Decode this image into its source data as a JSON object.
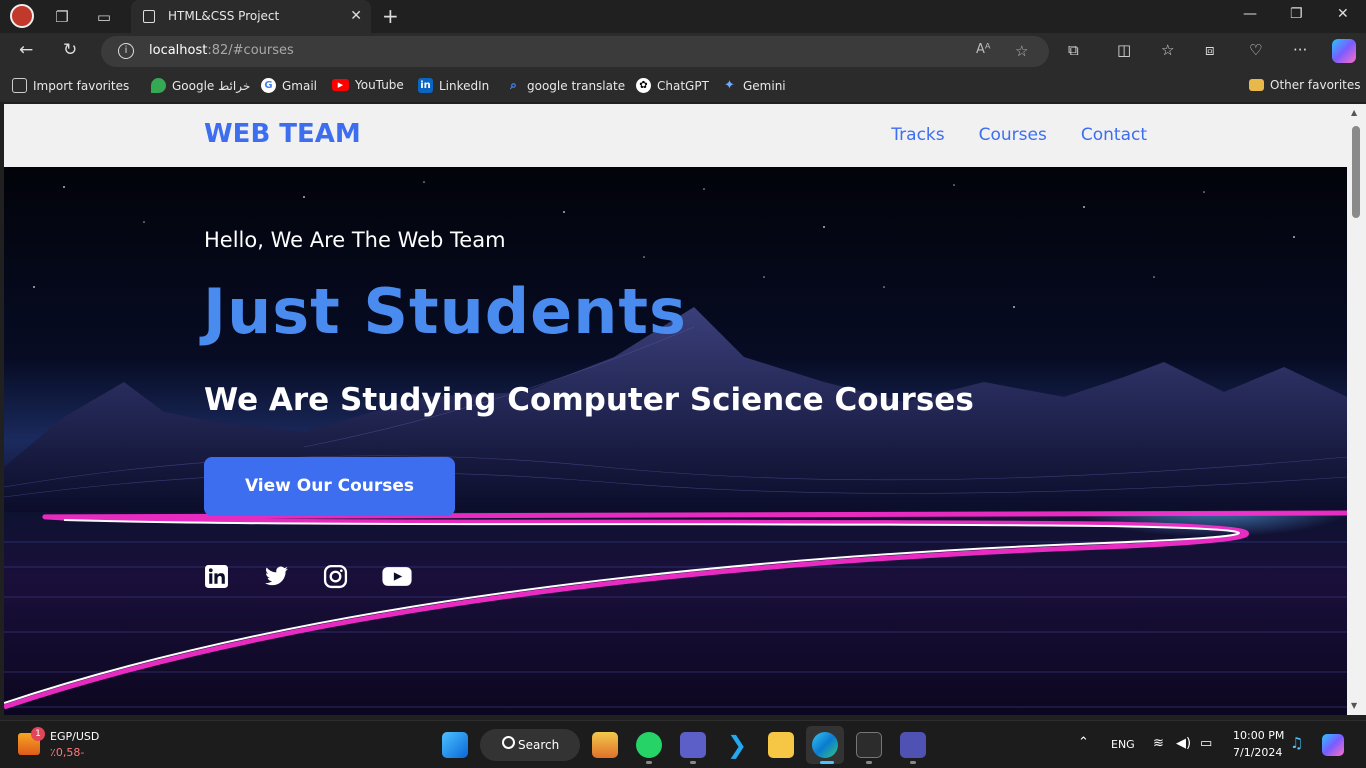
{
  "browser": {
    "tab_title": "HTML&CSS Project",
    "url_host": "localhost",
    "url_rest": ":82/#courses",
    "favorites": [
      {
        "label": "Import favorites",
        "icon": "import-icon"
      },
      {
        "label": "Google خرائط",
        "icon": "google-maps-icon"
      },
      {
        "label": "Gmail",
        "icon": "google-icon"
      },
      {
        "label": "YouTube",
        "icon": "youtube-icon"
      },
      {
        "label": "LinkedIn",
        "icon": "linkedin-icon"
      },
      {
        "label": "google translate",
        "icon": "search-icon"
      },
      {
        "label": "ChatGPT",
        "icon": "chatgpt-icon"
      },
      {
        "label": "Gemini",
        "icon": "gemini-icon"
      }
    ],
    "other_favorites": "Other favorites"
  },
  "site": {
    "logo": "WEB TEAM",
    "nav": [
      "Tracks",
      "Courses",
      "Contact"
    ],
    "hero": {
      "greeting": "Hello, We Are The Web Team",
      "headline": "Just Students",
      "subheadline": "We Are Studying Computer Science Courses",
      "cta": "View Our Courses"
    },
    "social": [
      "linkedin-icon",
      "twitter-icon",
      "instagram-icon",
      "youtube-icon"
    ]
  },
  "taskbar": {
    "widget_title": "EGP/USD",
    "widget_value": "٪0,58-",
    "widget_badge": "1",
    "search": "Search",
    "lang": "ENG",
    "time": "10:00 PM",
    "date": "7/1/2024"
  },
  "colors": {
    "accent": "#3e6ef0",
    "headline": "#4a8bf0",
    "header_bg": "#f1f1f1"
  }
}
